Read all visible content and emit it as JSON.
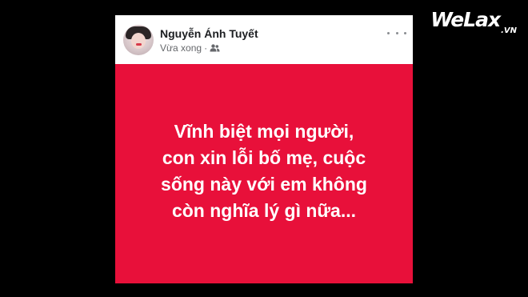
{
  "watermark": {
    "brand": "WeLax",
    "suffix": ".VN"
  },
  "post": {
    "author_name": "Nguyễn Ánh Tuyết",
    "timestamp": "Vừa xong",
    "separator": "·",
    "audience_icon": "friends-icon",
    "more_icon": "more-options-icon",
    "avatar_icon": "profile-photo",
    "background_color": "#e8103a",
    "text_lines": [
      "Vĩnh biệt mọi người,",
      "con xin lỗi bố mẹ, cuộc",
      "sống này với em không",
      "còn nghĩa lý gì nữa..."
    ]
  }
}
